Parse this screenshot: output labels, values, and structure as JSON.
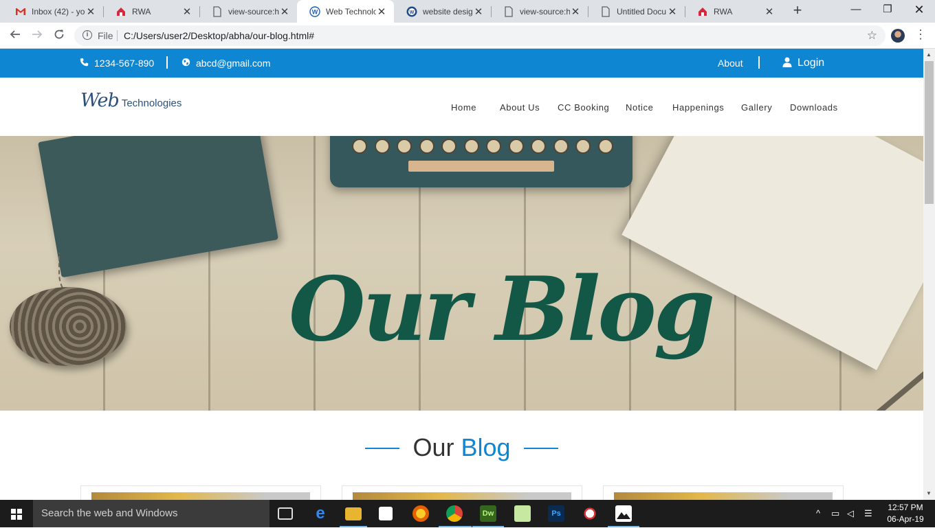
{
  "browser": {
    "tabs": [
      {
        "title": "Inbox (42) - yo",
        "favicon": "gmail-icon",
        "active": false
      },
      {
        "title": "RWA",
        "favicon": "rwa-icon",
        "active": false
      },
      {
        "title": "view-source:ht",
        "favicon": "document-icon",
        "active": false
      },
      {
        "title": "Web Technolo",
        "favicon": "w-logo-icon",
        "active": true
      },
      {
        "title": "website design",
        "favicon": "wordpress-icon",
        "active": false
      },
      {
        "title": "view-source:ht",
        "favicon": "document-icon",
        "active": false
      },
      {
        "title": "Untitled Docu",
        "favicon": "document-icon",
        "active": false
      },
      {
        "title": "RWA",
        "favicon": "rwa-icon",
        "active": false
      }
    ],
    "address": {
      "scheme_label": "File",
      "url": "C:/Users/user2/Desktop/abha/our-blog.html#"
    }
  },
  "site": {
    "topbar": {
      "phone": "1234-567-890",
      "email": "abcd@gmail.com",
      "about_label": "About",
      "login_label": "Login"
    },
    "logo": {
      "script": "Web",
      "text": "Technologies"
    },
    "nav": [
      "Home",
      "About Us",
      "CC Booking",
      "Notice",
      "Happenings",
      "Gallery",
      "Downloads"
    ],
    "hero": {
      "title": "Our Blog"
    },
    "section": {
      "title_plain": "Our",
      "title_accent": "Blog"
    }
  },
  "colors": {
    "brand_blue": "#0f86d1",
    "hero_title_green": "#135846",
    "logo_navy": "#2a4f7b"
  },
  "taskbar": {
    "search_placeholder": "Search the web and Windows",
    "apps": [
      "task-view-icon",
      "edge-icon",
      "file-explorer-icon",
      "store-icon",
      "firefox-icon",
      "chrome-icon",
      "dreamweaver-icon",
      "notepad-icon",
      "photoshop-icon",
      "snipping-tool-icon",
      "photos-icon"
    ],
    "clock": {
      "time": "12:57 PM",
      "date": "06-Apr-19"
    }
  }
}
